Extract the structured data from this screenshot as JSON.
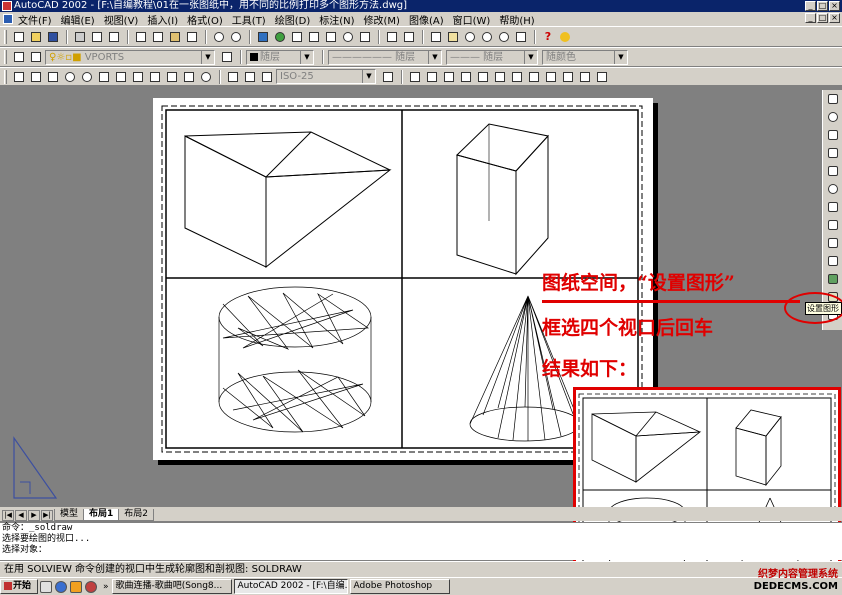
{
  "window": {
    "title": "AutoCAD 2002 - [F:\\自编教程\\01在一张图纸中，用不同的比例打印多个图形方法.dwg]",
    "buttons": [
      "_",
      "□",
      "×"
    ]
  },
  "menubar": {
    "items": [
      "文件(F)",
      "编辑(E)",
      "视图(V)",
      "插入(I)",
      "格式(O)",
      "工具(T)",
      "绘图(D)",
      "标注(N)",
      "修改(M)",
      "图像(A)",
      "窗口(W)",
      "帮助(H)"
    ],
    "doc_buttons": [
      "_",
      "□",
      "×"
    ]
  },
  "toolbar2": {
    "layer_combo": "VPORTS",
    "color_combo": "随层",
    "linetype_combo": "—————— 随层",
    "lineweight_combo": "——— 随层",
    "plotstyle_combo": "随颜色"
  },
  "toolbar3": {
    "dimstyle_combo": "ISO-25"
  },
  "layout_tabs": {
    "tabs": [
      "模型",
      "布局1",
      "布局2"
    ],
    "active": "布局1"
  },
  "command_line": {
    "lines": [
      "命令：_soldraw",
      "选择要绘图的视口...",
      "选择对象："
    ]
  },
  "status_bar": {
    "text": "在用 SOLVIEW 命令创建的视口中生成轮廓图和剖视图:  SOLDRAW"
  },
  "annotations": {
    "line1": "图纸空间，“设置图形”",
    "line2": "框选四个视口后回车",
    "line3": "结果如下："
  },
  "tooltip": "设置图形",
  "taskbar": {
    "start": "开始",
    "tasks": [
      "歌曲连播-歌曲吧(Song8...",
      "AutoCAD 2002 - [F:\\自编...",
      "Adobe Photoshop"
    ]
  },
  "watermark": {
    "line1": "织梦内容管理系统",
    "line2": "DEDECMS.COM"
  },
  "colors": {
    "annotation": "#e00000",
    "titlebar": "#0a246a",
    "chrome": "#d4d0c8",
    "canvas": "#808080"
  }
}
